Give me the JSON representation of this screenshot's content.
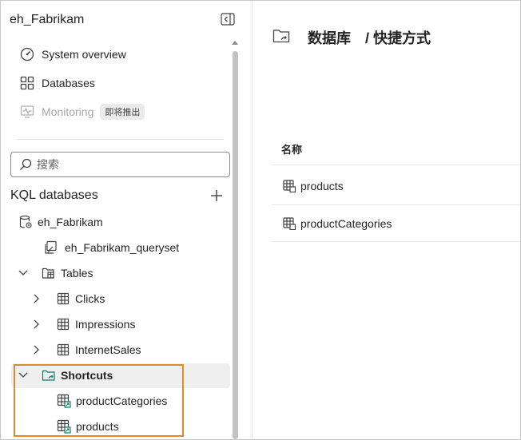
{
  "sidebar": {
    "workspace_title": "eh_Fabrikam",
    "nav": [
      {
        "label": "System overview",
        "icon": "gauge-icon"
      },
      {
        "label": "Databases",
        "icon": "grid-icon"
      },
      {
        "label": "Monitoring",
        "icon": "monitor-icon",
        "badge": "即将推出",
        "disabled": true
      }
    ],
    "search": {
      "placeholder": "搜索"
    },
    "kql_header": "KQL databases",
    "tree": {
      "database": "eh_Fabrikam",
      "queryset": "eh_Fabrikam_queryset",
      "tables_folder": "Tables",
      "tables": [
        "Clicks",
        "Impressions",
        "InternetSales"
      ],
      "shortcuts_folder": "Shortcuts",
      "shortcuts": [
        "productCategories",
        "products"
      ]
    }
  },
  "main": {
    "breadcrumb_root": "数据库",
    "breadcrumb_current": "/ 快捷方式",
    "column_header": "名称",
    "rows": [
      "products",
      "productCategories"
    ]
  },
  "colors": {
    "highlight": "#e08a2a",
    "folder_accent": "#0f7b6c"
  }
}
